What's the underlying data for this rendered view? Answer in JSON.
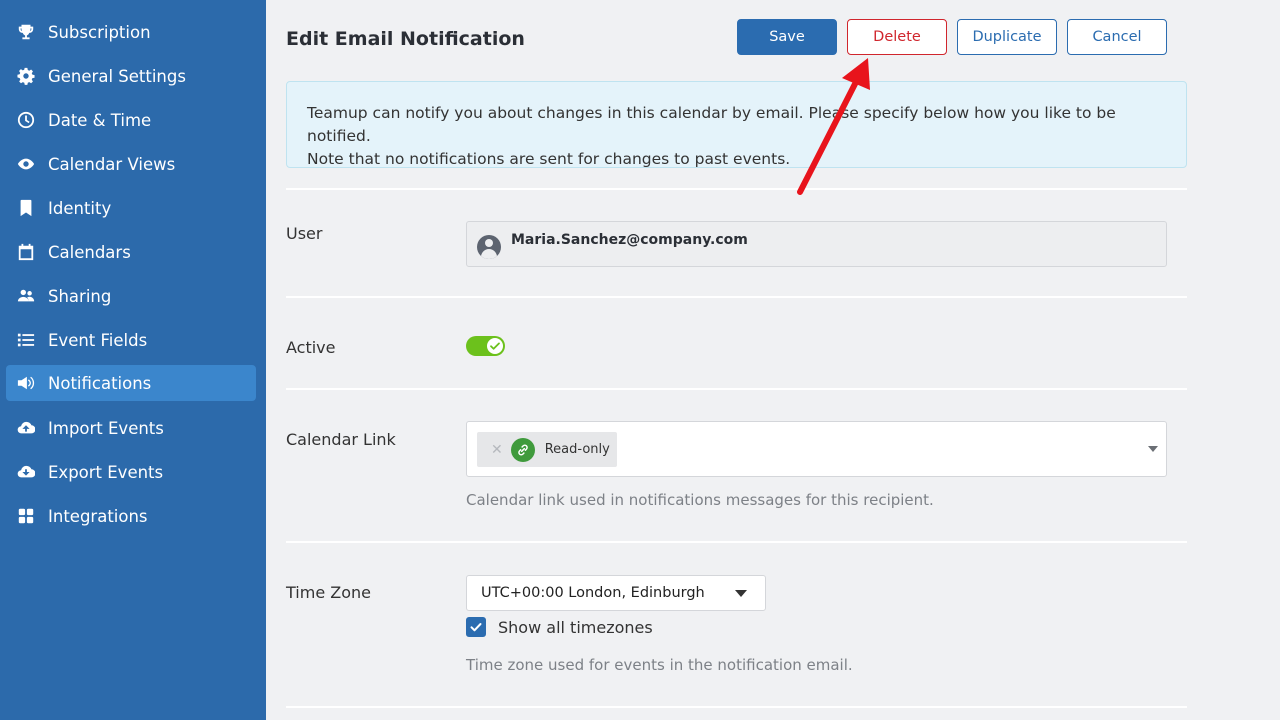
{
  "sidebar": {
    "items": [
      {
        "label": "Subscription",
        "icon": "trophy-icon"
      },
      {
        "label": "General Settings",
        "icon": "gear-icon"
      },
      {
        "label": "Date & Time",
        "icon": "clock-icon"
      },
      {
        "label": "Calendar Views",
        "icon": "eye-icon"
      },
      {
        "label": "Identity",
        "icon": "bookmark-icon"
      },
      {
        "label": "Calendars",
        "icon": "calendar-icon"
      },
      {
        "label": "Sharing",
        "icon": "users-icon"
      },
      {
        "label": "Event Fields",
        "icon": "list-icon"
      },
      {
        "label": "Notifications",
        "icon": "megaphone-icon",
        "active": true
      },
      {
        "label": "Import Events",
        "icon": "cloud-upload-icon"
      },
      {
        "label": "Export Events",
        "icon": "cloud-download-icon"
      },
      {
        "label": "Integrations",
        "icon": "grid-icon"
      }
    ]
  },
  "header": {
    "title": "Edit Email Notification",
    "save_label": "Save",
    "delete_label": "Delete",
    "duplicate_label": "Duplicate",
    "cancel_label": "Cancel"
  },
  "info": {
    "line1": "Teamup can notify you about changes in this calendar by email. Please specify below how you like to be notified.",
    "line2": "Note that no notifications are sent for changes to past events."
  },
  "user": {
    "label": "User",
    "email": "Maria.Sanchez@company.com"
  },
  "active": {
    "label": "Active",
    "enabled": true
  },
  "calendar_link": {
    "label": "Calendar Link",
    "chip_label": "Read-only",
    "help": "Calendar link used in notifications messages for this recipient."
  },
  "timezone": {
    "label": "Time Zone",
    "selected": "UTC+00:00 London, Edinburgh",
    "show_all_label": "Show all timezones",
    "show_all_checked": true,
    "help": "Time zone used for events in the notification email."
  },
  "colors": {
    "sidebar_bg": "#2c6aab",
    "sidebar_active": "#3b86cc",
    "primary": "#2b6cb0",
    "danger": "#d0262d",
    "toggle_on": "#6cc11c",
    "annotation_arrow": "#e8141c"
  }
}
